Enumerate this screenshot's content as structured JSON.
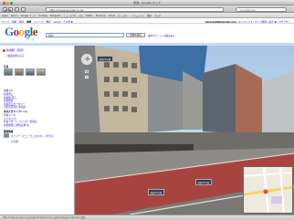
{
  "window": {
    "title": "新宿 - Google マップ"
  },
  "toolbar": {
    "url": "http://maps.google.co.jp/",
    "search_value": "googlemap"
  },
  "bookmarks": [
    "Apple",
    "Yahoo!",
    "Google マップ",
    "YouTube",
    "Wikipedia",
    "ニュース (2)",
    "人気",
    "Twitter",
    "Facebook",
    "Gmail",
    "カレンダー",
    "ドキュメント",
    "翻訳",
    "ブログ"
  ],
  "gbar": {
    "items": [
      "ウェブ",
      "画像",
      "動画",
      "地図",
      "ニュース",
      "翻訳",
      "Gmail",
      "その他 ▼"
    ],
    "active_index": 3,
    "user": "mlcarlos88@gmail.com",
    "links": "| マイプレイス | ウェブ履歴 | 設定 ▼ | ログアウト"
  },
  "maps": {
    "logo_letters": [
      "G",
      "o",
      "o",
      "g",
      "l",
      "e"
    ],
    "logo_colors": [
      "#3369e8",
      "#d50f25",
      "#eeb211",
      "#3369e8",
      "#009925",
      "#d50f25"
    ],
    "logo_sub": "マップ",
    "search_value": "新宿",
    "search_button": "地図を検索",
    "links": "検索オプション  地図を表示"
  },
  "sidebar": {
    "title": "新宿駅（東京）",
    "link1": "« 検索結果に戻る",
    "photos_label": "写真",
    "spots_label": "スポット",
    "spot_links": [
      "新宿西口",
      "新宿駅 西口",
      "新宿駅前",
      "新宿西口ロータリー",
      "小田急百貨店 新宿店"
    ],
    "related_label": "あなたがマイプレイス",
    "related_links": [
      "新宿ルミネ",
      "ルミネエスト",
      "新宿ミロード（ルミネ）新宿店",
      "新宿駅東口 駅前広場 前"
    ],
    "more_label": "関連情報",
    "more_link": "ストリートビューでこのスポットを見る",
    "footer_link": "その他"
  },
  "pano": {
    "street_labels": [
      "国道20号線",
      "国道20号線",
      "国道20号線"
    ]
  },
  "colors": {
    "accent_blue": "#c3d9ff",
    "road_red": "#a8443f",
    "link": "#2200cc"
  },
  "status": {
    "text": "http://maps.google.co.jp/maps?f=q&source=s_q&hl=ja&geocode=&q=新宿"
  }
}
